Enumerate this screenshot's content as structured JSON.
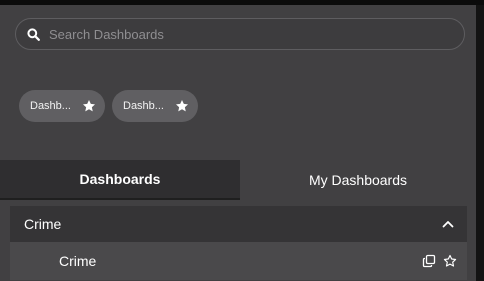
{
  "search": {
    "placeholder": "Search Dashboards"
  },
  "favorites": [
    {
      "label": "Dashb...",
      "icon": "star-icon"
    },
    {
      "label": "Dashb...",
      "icon": "star-icon"
    }
  ],
  "tabs": [
    {
      "label": "Dashboards",
      "active": true
    },
    {
      "label": "My Dashboards",
      "active": false
    }
  ],
  "section": {
    "title": "Crime",
    "expanded": true
  },
  "item": {
    "title": "Crime"
  },
  "colors": {
    "panel": "#414042",
    "chip": "#605f62",
    "active_tab": "#2f2e30",
    "section": "#353436",
    "row": "#4a494b",
    "text": "#ffffff"
  }
}
